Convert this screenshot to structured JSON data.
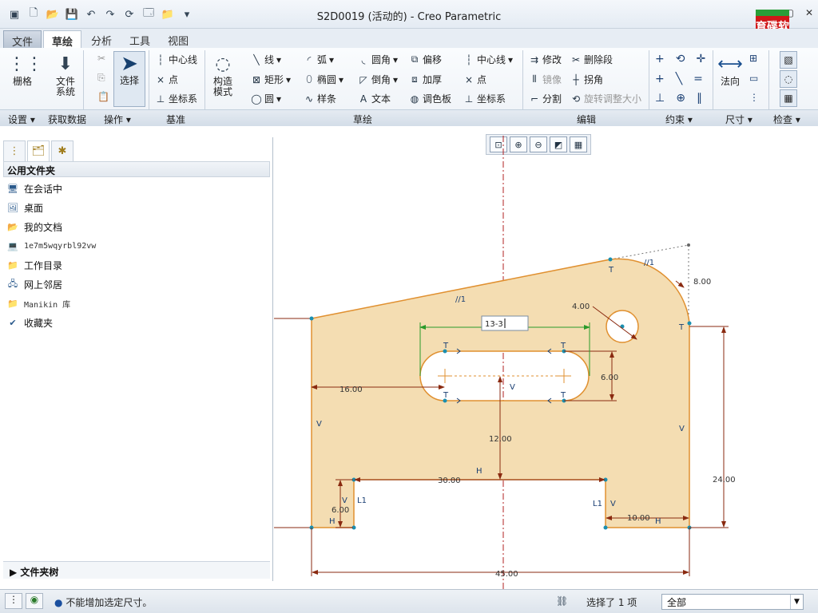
{
  "window": {
    "title": "S2D0019 (活动的) - Creo Parametric",
    "logo_text": "育碟软件"
  },
  "menu": {
    "tabs": [
      "文件",
      "草绘",
      "分析",
      "工具",
      "视图"
    ],
    "active": "草绘"
  },
  "ribbon": {
    "grid": "栅格",
    "filesys": "文件系统",
    "select": "选择",
    "construct": "构造模式",
    "datum": [
      "中心线",
      "点",
      "坐标系"
    ],
    "sketch_col1": [
      "线",
      "矩形",
      "圆"
    ],
    "sketch_col2": [
      "弧",
      "椭圆",
      "样条"
    ],
    "sketch_col3": [
      "圆角",
      "倒角",
      "文本"
    ],
    "sketch_col4": [
      "偏移",
      "加厚",
      "调色板"
    ],
    "sketch_col5": [
      "中心线",
      "点",
      "坐标系"
    ],
    "edit_col1": [
      "修改",
      "镜像",
      "分割"
    ],
    "edit_col2": [
      "删除段",
      "拐角",
      "旋转调整大小"
    ],
    "normal": "法向",
    "groups": [
      "设置",
      "获取数据",
      "操作",
      "基准",
      "草绘",
      "编辑",
      "约束",
      "尺寸",
      "检查"
    ]
  },
  "panel": {
    "header": "公用文件夹",
    "items": [
      "在会话中",
      "桌面",
      "我的文档",
      "1e7m5wqyrbl92vw",
      "工作目录",
      "网上邻居",
      "Manikin 库",
      "收藏夹"
    ],
    "footer": "文件夹树"
  },
  "sketch": {
    "dims": {
      "d16": "16.00",
      "d6a": "6.00",
      "d12": "12.00",
      "d4": "4.00",
      "d8": "8.00",
      "d30": "30.00",
      "d24": "24.00",
      "d6b": "6.00",
      "d10": "10.00",
      "d45": "45.00"
    },
    "edit_value": "13-3",
    "markers": {
      "T": "T",
      "V": "V",
      "H": "H",
      "L1": "L1",
      "c1": "//1",
      "c2": "//1"
    }
  },
  "status": {
    "message": "不能增加选定尺寸。",
    "selected": "选择了 1 项",
    "filter": "全部"
  }
}
